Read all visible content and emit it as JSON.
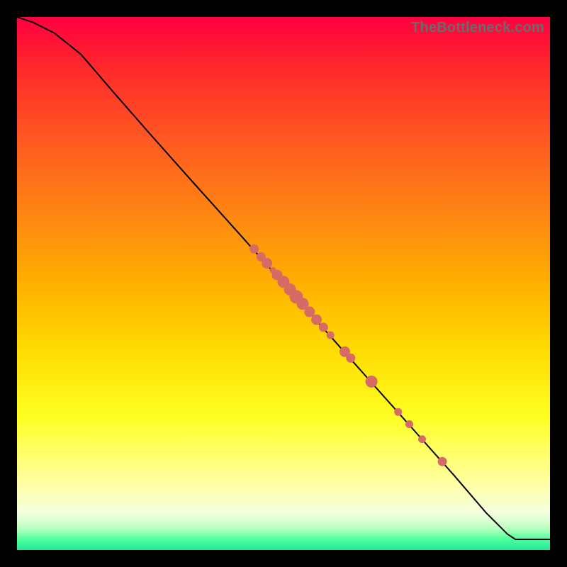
{
  "watermark": "TheBottleneck.com",
  "colors": {
    "background": "#000000",
    "curve": "#000000",
    "dot": "#d66b66"
  },
  "chart_data": {
    "type": "line",
    "title": "",
    "xlabel": "",
    "ylabel": "",
    "xlim": [
      0,
      100
    ],
    "ylim": [
      0,
      100
    ],
    "grid": false,
    "curve": {
      "x": [
        0,
        3,
        7,
        12,
        18,
        25,
        33,
        42,
        50,
        58,
        66,
        74,
        82,
        88,
        92,
        93.5,
        100
      ],
      "y": [
        100,
        99,
        97,
        93,
        86,
        78,
        69,
        59,
        50,
        41,
        32,
        23,
        14,
        7,
        3,
        2,
        2
      ]
    },
    "series": [
      {
        "name": "points",
        "points": [
          {
            "x": 44.5,
            "y": 56.5,
            "r": 6
          },
          {
            "x": 45.8,
            "y": 55.0,
            "r": 6
          },
          {
            "x": 46.9,
            "y": 53.8,
            "r": 7
          },
          {
            "x": 48.0,
            "y": 52.5,
            "r": 4
          },
          {
            "x": 48.8,
            "y": 51.6,
            "r": 7
          },
          {
            "x": 50.0,
            "y": 50.3,
            "r": 8
          },
          {
            "x": 51.2,
            "y": 48.9,
            "r": 8
          },
          {
            "x": 52.4,
            "y": 47.5,
            "r": 9
          },
          {
            "x": 53.6,
            "y": 46.2,
            "r": 8
          },
          {
            "x": 54.9,
            "y": 44.7,
            "r": 7
          },
          {
            "x": 56.2,
            "y": 43.2,
            "r": 7
          },
          {
            "x": 57.5,
            "y": 41.8,
            "r": 6
          },
          {
            "x": 58.8,
            "y": 40.3,
            "r": 5
          },
          {
            "x": 61.5,
            "y": 37.2,
            "r": 7
          },
          {
            "x": 62.6,
            "y": 36.0,
            "r": 6
          },
          {
            "x": 66.5,
            "y": 31.6,
            "r": 8
          },
          {
            "x": 71.5,
            "y": 25.9,
            "r": 5
          },
          {
            "x": 73.6,
            "y": 23.6,
            "r": 5
          },
          {
            "x": 76.0,
            "y": 20.8,
            "r": 5
          },
          {
            "x": 79.8,
            "y": 16.6,
            "r": 6
          }
        ]
      }
    ]
  }
}
